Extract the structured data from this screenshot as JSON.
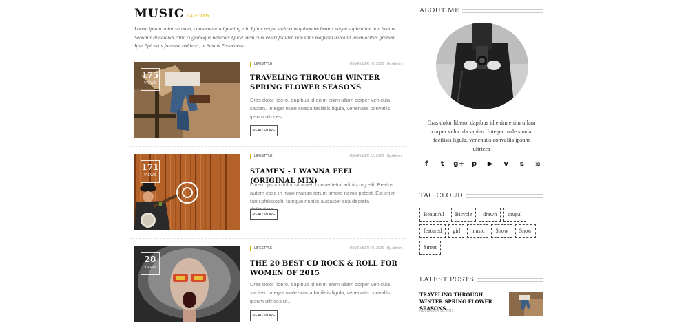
{
  "category": {
    "title": "MUSIC",
    "label": "CATEGORY",
    "description": "Lorem ipsum dolor sit amet, consectetur adipiscing elit. Igitur neque stultorum quisquam beatus neque sapientium non beatus. Sequitur disserendi ratio cognitioque naturae; Quod idem cum vestri faciant, non satis magnam tribuunt inventoribus gratiam. Ipse Epicurus fortasse redderet, ut Sextus Peducaeus."
  },
  "posts": [
    {
      "views": "175",
      "views_label": "VIEWS",
      "tag": "LIFESTYLE",
      "date": "NOVEMBER 16, 2015",
      "author": "By Admin",
      "title": "TRAVELING THROUGH WINTER SPRING FLOWER SEASONS",
      "excerpt": "Cras dolor libero, dapibus id enim enim ullam corper vehicula sapien. Integer male suada facilisis ligula, venenatis convallis ipsum ultrices...",
      "read_more": "READ MORE",
      "image_icon": "photo-jeans-man"
    },
    {
      "views": "171",
      "views_label": "VIEWS",
      "tag": "LIFESTYLE",
      "date": "NOVEMBER 12, 2015",
      "author": "By Admin",
      "title": "STAMEN - I WANNA FEEL (ORIGINAL MIX)",
      "excerpt": "Lorem ipsum dolor sit amet, consectetur adipiscing elit. Beatus autem esse in maxi marum rerum timore nemo potest. Est enim tanti philosophi tamque nobilis audacter sua decreta defendere.....",
      "read_more": "READ MORE",
      "image_icon": "photo-banjo-player"
    },
    {
      "views": "28",
      "views_label": "VIEWS",
      "tag": "LIFESTYLE",
      "date": "NOVEMBER 04, 2015",
      "author": "By Admin",
      "title": "THE 20 BEST CD ROCK & ROLL FOR WOMEN OF 2015",
      "excerpt": "Cras dolor libero, dapibus id enim enim ullam corper vehicula sapien. Integer male suada facilisis ligula, venenatis convallis ipsum ultrices ut...",
      "read_more": "READ MORE",
      "image_icon": "photo-rock-woman"
    }
  ],
  "sidebar": {
    "about_title": "ABOUT ME",
    "about_text": "Cras dolor libero, dapibus id enim enim ullam corper vehicula sapien. Integer male suada facilisis ligula, venenatis convallis ipsum ultrices",
    "social_icons": [
      {
        "name": "facebook-icon",
        "glyph": "f"
      },
      {
        "name": "twitter-icon",
        "glyph": "t"
      },
      {
        "name": "google-plus-icon",
        "glyph": "g+"
      },
      {
        "name": "pinterest-icon",
        "glyph": "p"
      },
      {
        "name": "youtube-icon",
        "glyph": "▶"
      },
      {
        "name": "vimeo-icon",
        "glyph": "v"
      },
      {
        "name": "skype-icon",
        "glyph": "s"
      },
      {
        "name": "rss-icon",
        "glyph": "≋"
      }
    ],
    "tag_cloud_title": "TAG CLOUD",
    "tags": [
      "Beautiful",
      "Bicycle",
      "drawn",
      "drupal",
      "featured",
      "girl",
      "music",
      "Snow",
      "Snow",
      "Street"
    ],
    "latest_title": "LATEST POSTS",
    "latest_post": {
      "title": "TRAVELING THROUGH WINTER SPRING FLOWER SEASONS",
      "date": "NOVEMBER 16, 2015"
    }
  },
  "colors": {
    "accent": "#e3b400",
    "text": "#222222",
    "muted": "#777777"
  }
}
